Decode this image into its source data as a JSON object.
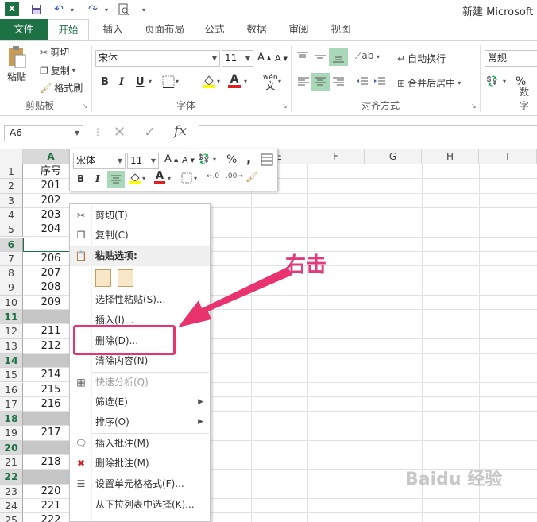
{
  "window": {
    "title": "新建 Microsoft E"
  },
  "tabs": [
    "文件",
    "开始",
    "插入",
    "页面布局",
    "公式",
    "数据",
    "审阅",
    "视图"
  ],
  "clipboard": {
    "paste": "粘贴",
    "cut": "剪切",
    "copy": "复制",
    "format_painter": "格式刷",
    "label": "剪贴板"
  },
  "font": {
    "name": "宋体",
    "size": "11",
    "label": "字体",
    "bold": "B",
    "italic": "I",
    "underline": "U",
    "phonetic": "wén"
  },
  "alignment": {
    "wrap": "自动换行",
    "merge": "合并后居中",
    "label": "对齐方式"
  },
  "number": {
    "format": "常规",
    "label": "数字",
    "percent": "%"
  },
  "formula_bar": {
    "name_box": "A6",
    "fx": "fx",
    "value": ""
  },
  "columns": [
    "A",
    "B",
    "C",
    "D",
    "E",
    "F",
    "G",
    "H",
    "I"
  ],
  "rows": [
    {
      "num": "1",
      "value": "序号",
      "state": "normal"
    },
    {
      "num": "2",
      "value": "201",
      "state": "normal"
    },
    {
      "num": "3",
      "value": "202",
      "state": "normal"
    },
    {
      "num": "4",
      "value": "203",
      "state": "normal"
    },
    {
      "num": "5",
      "value": "204",
      "state": "normal"
    },
    {
      "num": "6",
      "value": "",
      "state": "active"
    },
    {
      "num": "7",
      "value": "206",
      "state": "normal"
    },
    {
      "num": "8",
      "value": "207",
      "state": "normal"
    },
    {
      "num": "9",
      "value": "208",
      "state": "normal"
    },
    {
      "num": "10",
      "value": "209",
      "state": "normal"
    },
    {
      "num": "11",
      "value": "",
      "state": "selected"
    },
    {
      "num": "12",
      "value": "211",
      "state": "normal"
    },
    {
      "num": "13",
      "value": "212",
      "state": "normal"
    },
    {
      "num": "14",
      "value": "",
      "state": "selected"
    },
    {
      "num": "15",
      "value": "214",
      "state": "normal"
    },
    {
      "num": "16",
      "value": "215",
      "state": "normal"
    },
    {
      "num": "17",
      "value": "216",
      "state": "normal"
    },
    {
      "num": "18",
      "value": "",
      "state": "selected"
    },
    {
      "num": "19",
      "value": "217",
      "state": "normal"
    },
    {
      "num": "20",
      "value": "",
      "state": "selected"
    },
    {
      "num": "21",
      "value": "218",
      "state": "normal"
    },
    {
      "num": "22",
      "value": "",
      "state": "selected"
    },
    {
      "num": "23",
      "value": "220",
      "state": "normal"
    },
    {
      "num": "24",
      "value": "221",
      "state": "normal"
    },
    {
      "num": "25",
      "value": "222",
      "state": "normal"
    }
  ],
  "mini_toolbar": {
    "font": "宋体",
    "size": "11",
    "bold": "B",
    "italic": "I",
    "percent": "%",
    "comma": ","
  },
  "context_menu": [
    {
      "label": "剪切(T)",
      "icon": "scissors-icon",
      "glyph": "✂",
      "enabled": true
    },
    {
      "label": "复制(C)",
      "icon": "copy-icon",
      "glyph": "❐",
      "enabled": true
    },
    {
      "label": "粘贴选项:",
      "icon": "paste-icon",
      "glyph": "📋",
      "enabled": true,
      "header": true
    },
    {
      "label": "",
      "icon": "paste-options-icon",
      "glyph": "",
      "enabled": true,
      "icons_row": true
    },
    {
      "label": "选择性粘贴(S)...",
      "icon": "",
      "glyph": "",
      "enabled": true
    },
    {
      "label": "插入(I)...",
      "icon": "",
      "glyph": "",
      "enabled": true
    },
    {
      "label": "删除(D)...",
      "icon": "",
      "glyph": "",
      "enabled": true,
      "highlight": true
    },
    {
      "label": "清除内容(N)",
      "icon": "",
      "glyph": "",
      "enabled": true
    },
    {
      "label": "快速分析(Q)",
      "icon": "quick-analysis-icon",
      "glyph": "▦",
      "enabled": false
    },
    {
      "label": "筛选(E)",
      "icon": "",
      "glyph": "",
      "enabled": true,
      "submenu": true
    },
    {
      "label": "排序(O)",
      "icon": "",
      "glyph": "",
      "enabled": true,
      "submenu": true
    },
    {
      "label": "插入批注(M)",
      "icon": "insert-comment-icon",
      "glyph": "🗨",
      "enabled": true
    },
    {
      "label": "删除批注(M)",
      "icon": "delete-comment-icon",
      "glyph": "✖",
      "enabled": true
    },
    {
      "label": "设置单元格格式(F)...",
      "icon": "format-cells-icon",
      "glyph": "☰",
      "enabled": true
    },
    {
      "label": "从下拉列表中选择(K)...",
      "icon": "",
      "glyph": "",
      "enabled": true
    }
  ],
  "annotation": {
    "callout": "右击"
  },
  "watermark": "Baidu 经验",
  "colors": {
    "excel_green": "#1e7145",
    "arrow": "#e8336f",
    "highlight_box": "#e8336f"
  }
}
